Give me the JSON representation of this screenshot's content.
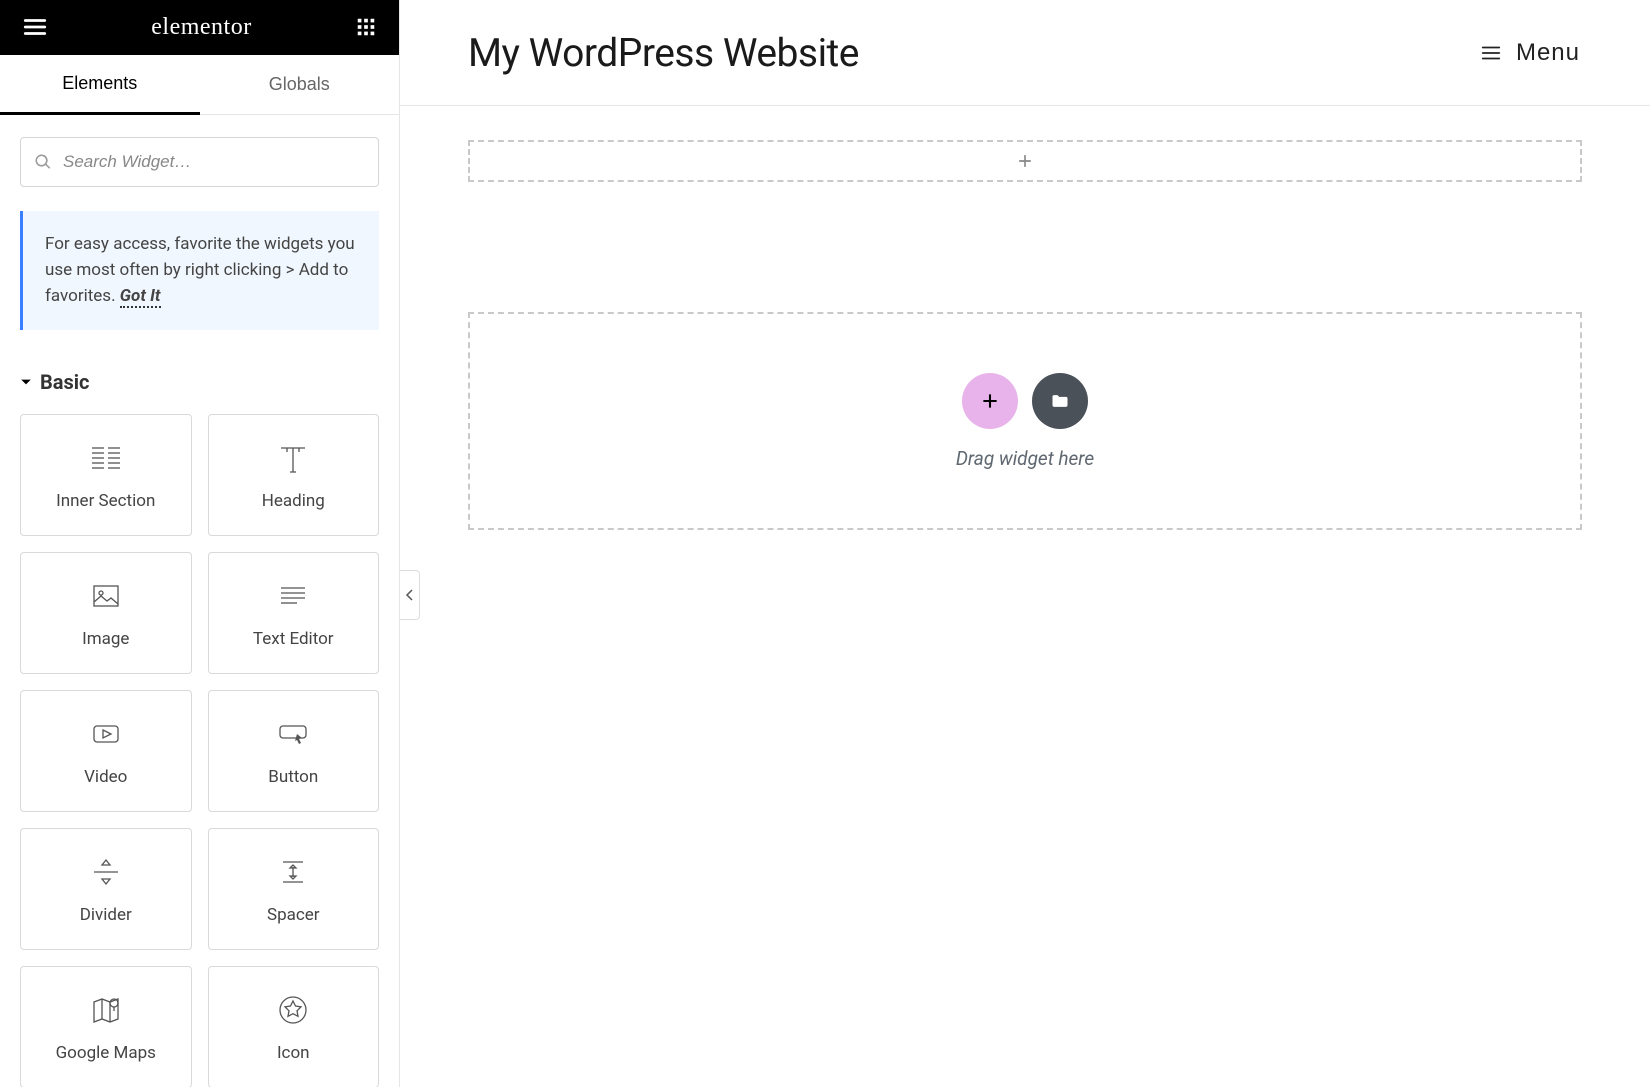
{
  "sidebar": {
    "brand": "elementor",
    "tabs": {
      "elements": "Elements",
      "globals": "Globals"
    },
    "search_placeholder": "Search Widget…",
    "tip_text": "For easy access, favorite the widgets you use most often by right clicking > Add to favorites.",
    "tip_gotit": "Got It",
    "category": "Basic",
    "widgets": [
      {
        "id": "inner-section",
        "label": "Inner Section"
      },
      {
        "id": "heading",
        "label": "Heading"
      },
      {
        "id": "image",
        "label": "Image"
      },
      {
        "id": "text-editor",
        "label": "Text Editor"
      },
      {
        "id": "video",
        "label": "Video"
      },
      {
        "id": "button",
        "label": "Button"
      },
      {
        "id": "divider",
        "label": "Divider"
      },
      {
        "id": "spacer",
        "label": "Spacer"
      },
      {
        "id": "google-maps",
        "label": "Google Maps"
      },
      {
        "id": "icon",
        "label": "Icon"
      }
    ]
  },
  "main": {
    "title": "My WordPress Website",
    "menu_label": "Menu",
    "drop_label": "Drag widget here"
  }
}
